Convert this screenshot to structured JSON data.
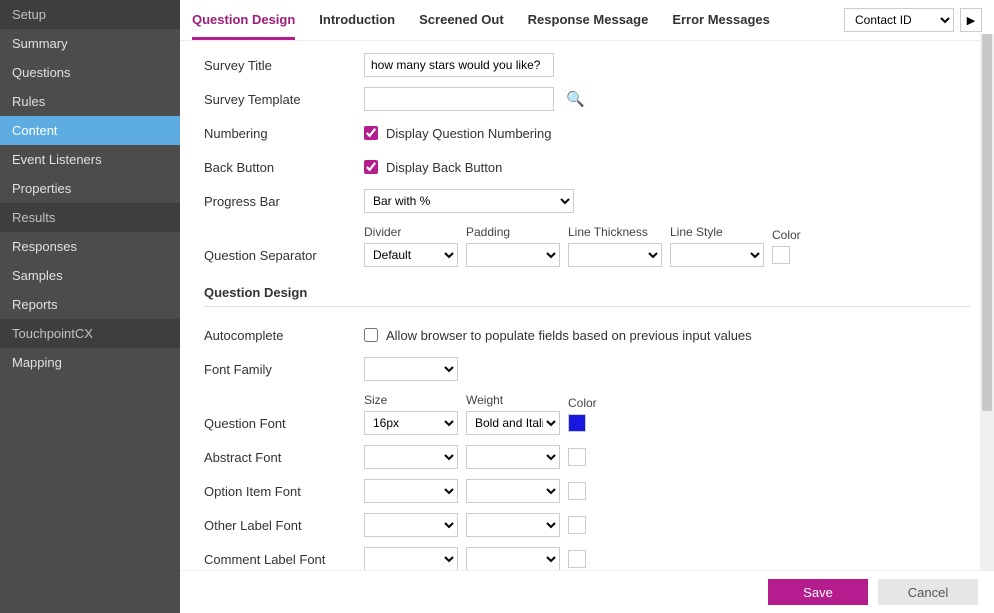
{
  "sidebar": {
    "groups": [
      {
        "title": "Setup",
        "items": [
          "Summary",
          "Questions",
          "Rules",
          "Content",
          "Event Listeners",
          "Properties"
        ],
        "active": "Content"
      },
      {
        "title": "Results",
        "items": [
          "Responses",
          "Samples",
          "Reports"
        ]
      },
      {
        "title": "TouchpointCX",
        "items": [
          "Mapping"
        ]
      }
    ]
  },
  "tabs": [
    "Question Design",
    "Introduction",
    "Screened Out",
    "Response Message",
    "Error Messages"
  ],
  "activeTab": "Question Design",
  "topSelect": "Contact ID",
  "labels": {
    "surveyTitle": "Survey Title",
    "surveyTemplate": "Survey Template",
    "numbering": "Numbering",
    "backButton": "Back Button",
    "progressBar": "Progress Bar",
    "questionSeparator": "Question Separator",
    "autocomplete": "Autocomplete",
    "fontFamily": "Font Family",
    "questionFont": "Question Font",
    "abstractFont": "Abstract Font",
    "optionItemFont": "Option Item Font",
    "otherLabelFont": "Other Label Font",
    "commentLabelFont": "Comment Label Font",
    "sectionQuestionDesign": "Question Design"
  },
  "values": {
    "surveyTitle": "how many stars would you like?",
    "surveyTemplate": "",
    "displayQuestionNumbering": true,
    "displayBackButton": true,
    "progressBar": "Bar with %",
    "allowAutocomplete": false,
    "questionFontSize": "16px",
    "questionFontWeight": "Bold and Italic",
    "questionFontColor": "#1818e0"
  },
  "checkboxText": {
    "displayQuestionNumbering": "Display Question Numbering",
    "displayBackButton": "Display Back Button",
    "allowAutocomplete": "Allow browser to populate fields based on previous input values"
  },
  "sepCols": {
    "divider": "Divider",
    "padding": "Padding",
    "lineThickness": "Line Thickness",
    "lineStyle": "Line Style",
    "color": "Color",
    "dividerVal": "Default"
  },
  "fontCols": {
    "size": "Size",
    "weight": "Weight",
    "color": "Color"
  },
  "buttons": {
    "save": "Save",
    "cancel": "Cancel"
  }
}
